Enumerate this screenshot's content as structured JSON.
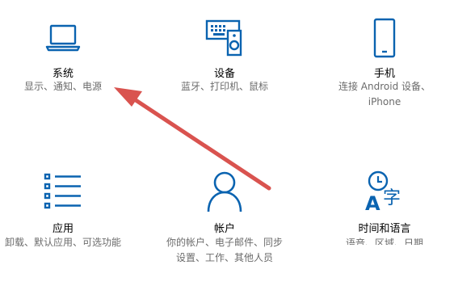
{
  "colors": {
    "accent": "#0a63b0",
    "label": "#000000",
    "description": "#6b6b6b",
    "arrow": "#d9534f"
  },
  "tiles": [
    {
      "id": "system",
      "icon": "laptop-icon",
      "label": "系统",
      "desc_lines": [
        "显示、通知、电源"
      ]
    },
    {
      "id": "devices",
      "icon": "keyboard-speaker-icon",
      "label": "设备",
      "desc_lines": [
        "蓝牙、打印机、鼠标"
      ]
    },
    {
      "id": "phone",
      "icon": "phone-icon",
      "label": "手机",
      "desc_lines": [
        "连接 Android 设备、",
        "iPhone"
      ]
    },
    {
      "id": "apps",
      "icon": "list-icon",
      "label": "应用",
      "desc_lines": [
        "卸载、默认应用、可选功能"
      ]
    },
    {
      "id": "accounts",
      "icon": "person-icon",
      "label": "帐户",
      "desc_lines": [
        "你的帐户、电子邮件、同步",
        "设置、工作、其他人员"
      ]
    },
    {
      "id": "time",
      "icon": "clock-language-icon",
      "label": "时间和语言",
      "desc_lines": [
        "语音、区域、日期"
      ]
    }
  ]
}
